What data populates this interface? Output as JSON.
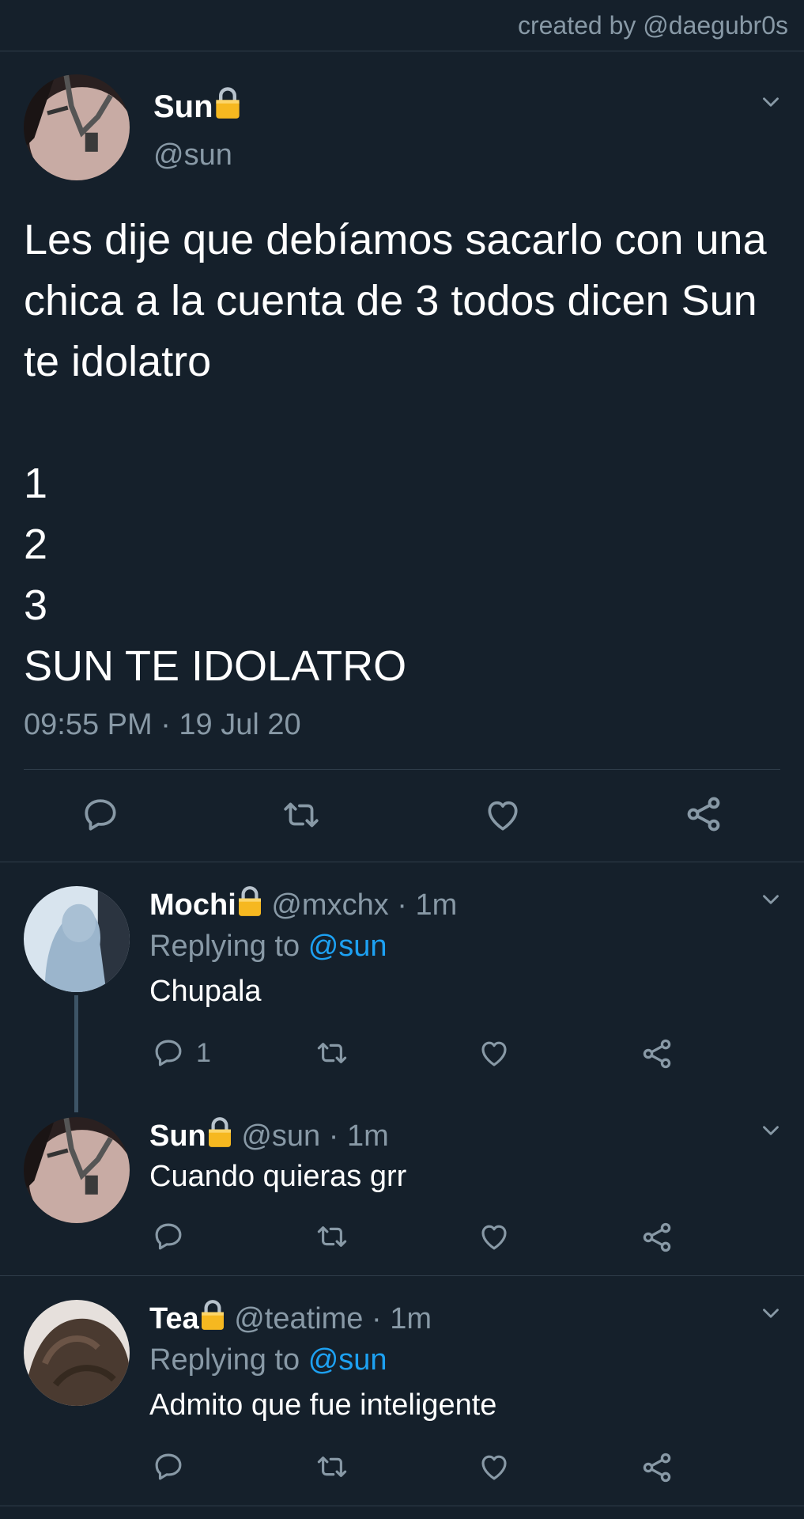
{
  "credit": "created by @daegubr0s",
  "main_tweet": {
    "name": "Sun",
    "handle": "@sun",
    "text": "Les dije que debíamos sacarlo con una chica a la cuenta de 3 todos dicen Sun te idolatro\n\n1\n2\n3\nSUN TE IDOLATRO",
    "timestamp": "09:55 PM · 19 Jul 20",
    "actions": [
      "reply-icon",
      "retweet-icon",
      "like-icon",
      "share-icon"
    ]
  },
  "replies": [
    {
      "name": "Mochi",
      "handle": "@mxchx",
      "time": "· 1m",
      "replying_prefix": "Replying to",
      "replying_to": "@sun",
      "text": "Chupala",
      "reply_count": "1"
    },
    {
      "name": "Sun",
      "handle": "@sun",
      "time": "· 1m",
      "text": "Cuando quieras grr"
    },
    {
      "name": "Tea",
      "handle": "@teatime",
      "time": "· 1m",
      "replying_prefix": "Replying to",
      "replying_to": "@sun",
      "text": "Admito que fue inteligente"
    }
  ],
  "colors": {
    "background": "#15202b",
    "secondary_text": "#8899a6",
    "mention": "#1da1f2",
    "divider": "#2f3d4a"
  }
}
